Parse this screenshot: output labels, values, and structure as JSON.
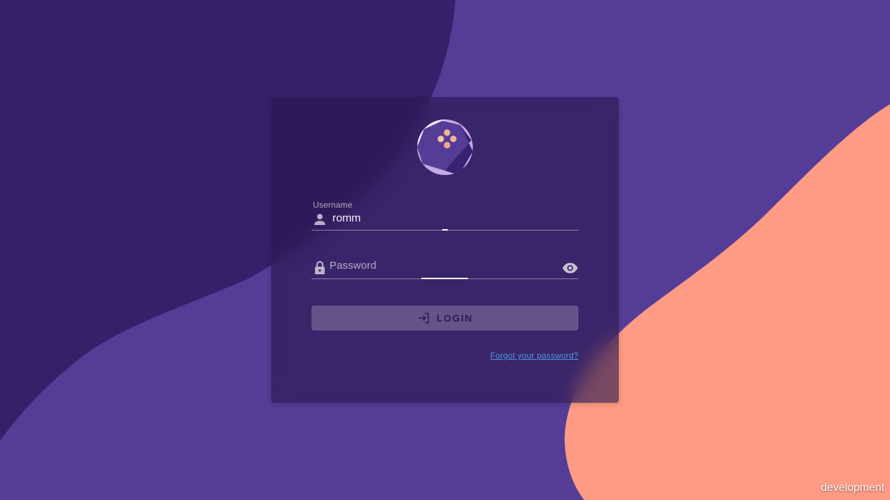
{
  "colors": {
    "background": "#553d97",
    "dark_blob": "#36206a",
    "coral_blob": "#ff9b84",
    "card": "#2a1650",
    "accent_link": "#4f9bdc"
  },
  "login": {
    "logo_icon": "romm-gamepad-logo",
    "username": {
      "label": "Username",
      "value": "romm",
      "icon": "person-icon"
    },
    "password": {
      "placeholder": "Password",
      "icon": "lock-icon",
      "toggle_icon": "eye-icon"
    },
    "submit": {
      "label": "LOGIN",
      "icon": "login-icon"
    },
    "forgot_link": "Forgot your password?"
  },
  "environment": "development"
}
